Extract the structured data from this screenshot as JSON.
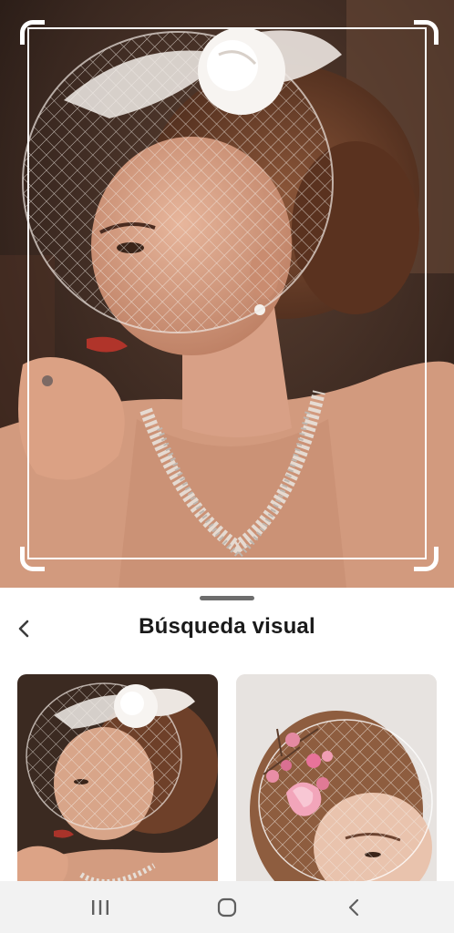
{
  "visual_search": {
    "title": "Búsqueda visual",
    "back_icon": "chevron-left-icon",
    "results": [
      {
        "name": "result-birdcage-veil-feather-flower",
        "icon": "image-thumbnail"
      },
      {
        "name": "result-birdcage-veil-pink-blossoms",
        "icon": "image-thumbnail"
      }
    ]
  },
  "photo": {
    "icon": "search-photo",
    "crop_handles": "crop-corner-icon"
  },
  "navbar": {
    "recents_icon": "recents-icon",
    "home_icon": "home-icon",
    "back_icon": "back-icon"
  },
  "colors": {
    "sheet_background": "#ffffff",
    "title_text": "#1a1a1a",
    "navbar_background": "#f2f2f2",
    "navbar_icons": "#5f5f5f",
    "crop_frame": "#ffffff"
  }
}
